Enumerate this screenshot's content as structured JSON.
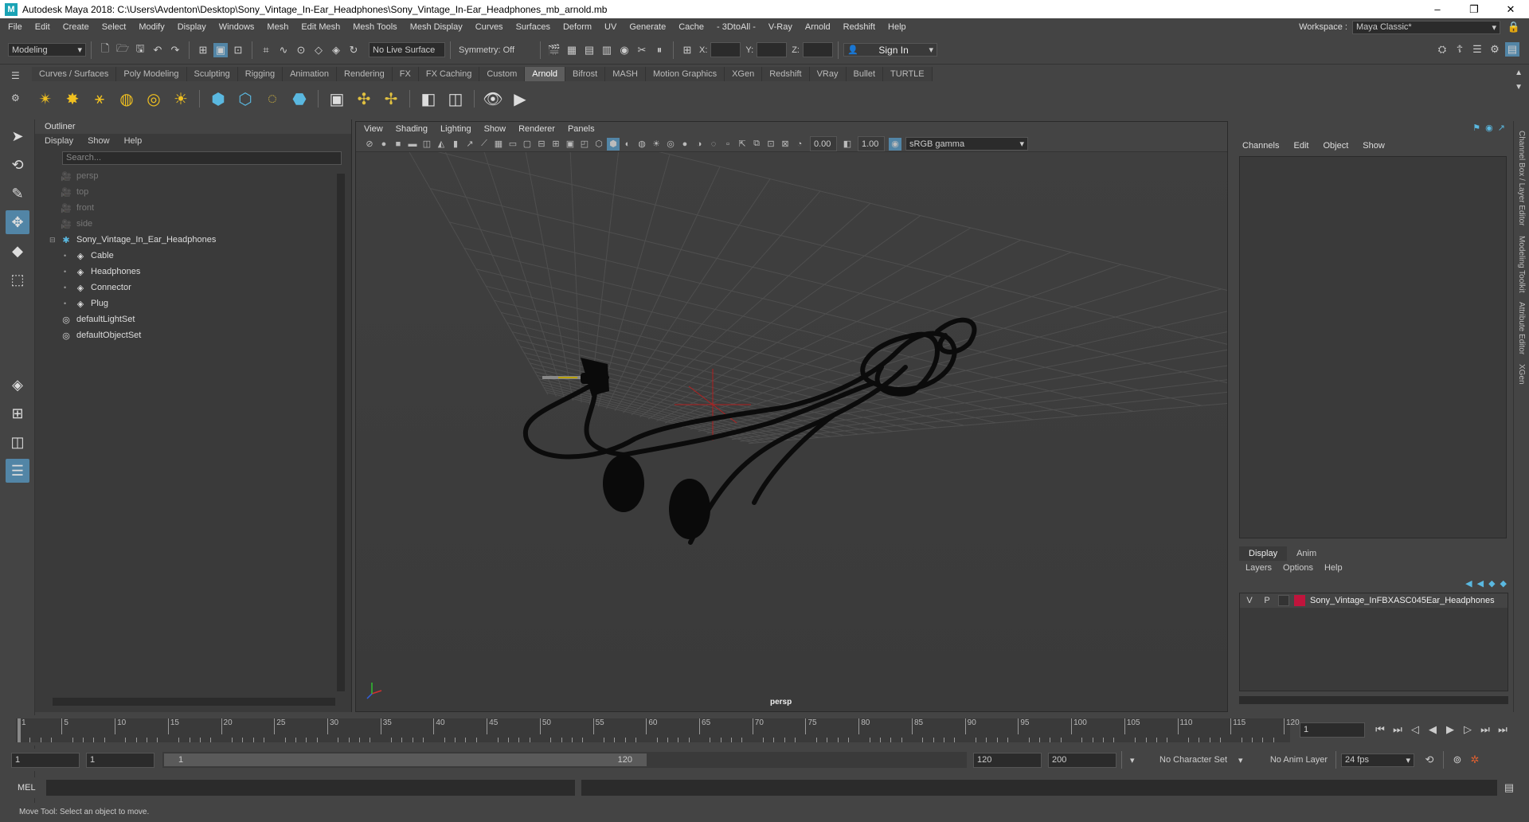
{
  "window": {
    "title": "Autodesk Maya 2018: C:\\Users\\Avdenton\\Desktop\\Sony_Vintage_In-Ear_Headphones\\Sony_Vintage_In-Ear_Headphones_mb_arnold.mb",
    "minimize": "–",
    "maximize": "❐",
    "close": "✕"
  },
  "menubar": {
    "items": [
      "File",
      "Edit",
      "Create",
      "Select",
      "Modify",
      "Display",
      "Windows",
      "Mesh",
      "Edit Mesh",
      "Mesh Tools",
      "Mesh Display",
      "Curves",
      "Surfaces",
      "Deform",
      "UV",
      "Generate",
      "Cache",
      "- 3DtoAll -",
      "V-Ray",
      "Arnold",
      "Redshift",
      "Help"
    ],
    "workspace_label": "Workspace :",
    "workspace_value": "Maya Classic*"
  },
  "statusline": {
    "mode": "Modeling",
    "live_surface": "No Live Surface",
    "symmetry": "Symmetry: Off",
    "x_label": "X:",
    "y_label": "Y:",
    "z_label": "Z:",
    "sign_in": "Sign In"
  },
  "shelf": {
    "tabs": [
      "Curves / Surfaces",
      "Poly Modeling",
      "Sculpting",
      "Rigging",
      "Animation",
      "Rendering",
      "FX",
      "FX Caching",
      "Custom",
      "Arnold",
      "Bifrost",
      "MASH",
      "Motion Graphics",
      "XGen",
      "Redshift",
      "VRay",
      "Bullet",
      "TURTLE"
    ],
    "active_tab": "Arnold"
  },
  "outliner": {
    "title": "Outliner",
    "menu": [
      "Display",
      "Show",
      "Help"
    ],
    "search_placeholder": "Search...",
    "items": [
      {
        "label": "persp",
        "icon": "camera-icon",
        "dim": true,
        "indent": 0
      },
      {
        "label": "top",
        "icon": "camera-icon",
        "dim": true,
        "indent": 0
      },
      {
        "label": "front",
        "icon": "camera-icon",
        "dim": true,
        "indent": 0
      },
      {
        "label": "side",
        "icon": "camera-icon",
        "dim": true,
        "indent": 0
      },
      {
        "label": "Sony_Vintage_In_Ear_Headphones",
        "icon": "group-icon",
        "dim": false,
        "indent": 0,
        "expanded": true
      },
      {
        "label": "Cable",
        "icon": "mesh-icon",
        "dim": false,
        "indent": 1
      },
      {
        "label": "Headphones",
        "icon": "mesh-icon",
        "dim": false,
        "indent": 1
      },
      {
        "label": "Connector",
        "icon": "mesh-icon",
        "dim": false,
        "indent": 1
      },
      {
        "label": "Plug",
        "icon": "mesh-icon",
        "dim": false,
        "indent": 1
      },
      {
        "label": "defaultLightSet",
        "icon": "set-icon",
        "dim": false,
        "indent": 0
      },
      {
        "label": "defaultObjectSet",
        "icon": "set-icon",
        "dim": false,
        "indent": 0
      }
    ]
  },
  "viewport": {
    "menu": [
      "View",
      "Shading",
      "Lighting",
      "Show",
      "Renderer",
      "Panels"
    ],
    "exposure": "0.00",
    "gamma": "1.00",
    "color_space": "sRGB gamma",
    "camera_label": "persp"
  },
  "channelbox": {
    "menu": [
      "Channels",
      "Edit",
      "Object",
      "Show"
    ],
    "side_tabs": [
      "Channel Box / Layer Editor",
      "Modeling Toolkit",
      "Attribute Editor",
      "XGen"
    ]
  },
  "layers": {
    "tabs": [
      "Display",
      "Anim"
    ],
    "menu": [
      "Layers",
      "Options",
      "Help"
    ],
    "layer": {
      "v": "V",
      "p": "P",
      "name": "Sony_Vintage_InFBXASC045Ear_Headphones",
      "color": "#c0143c"
    }
  },
  "timeline": {
    "ticks": [
      1,
      5,
      10,
      15,
      20,
      25,
      30,
      35,
      40,
      45,
      50,
      55,
      60,
      65,
      70,
      75,
      80,
      85,
      90,
      95,
      100,
      105,
      110,
      115,
      120
    ],
    "current_frame": "1"
  },
  "range": {
    "start": "1",
    "start2": "1",
    "slider_start": "1",
    "slider_end": "120",
    "end": "120",
    "end2": "200",
    "character_set": "No Character Set",
    "anim_layer": "No Anim Layer",
    "fps": "24 fps"
  },
  "cmdline": {
    "label": "MEL"
  },
  "helpline": {
    "text": "Move Tool: Select an object to move."
  }
}
